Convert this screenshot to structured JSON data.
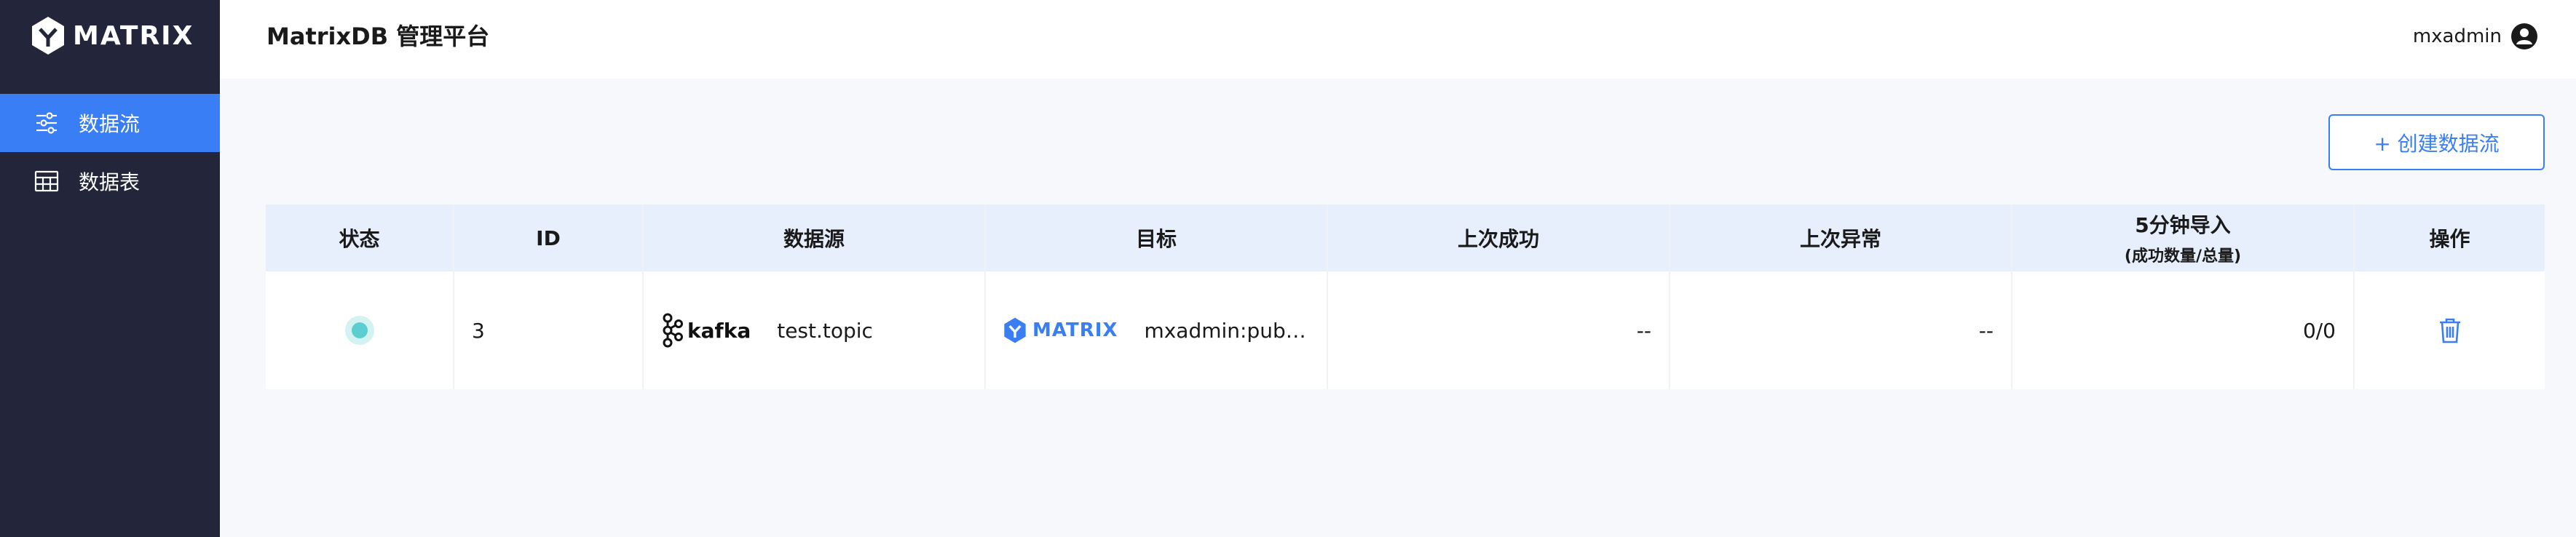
{
  "brand": {
    "name": "MATRIX",
    "accent": "#3a7ef6",
    "sidebar_bg": "#23263a"
  },
  "sidebar": {
    "items": [
      {
        "label": "数据流",
        "icon": "data-flow-icon",
        "active": true
      },
      {
        "label": "数据表",
        "icon": "table-icon",
        "active": false
      }
    ]
  },
  "header": {
    "title": "MatrixDB 管理平台",
    "user": {
      "name": "mxadmin",
      "icon": "user-avatar-icon"
    }
  },
  "toolbar": {
    "create_label": "+ 创建数据流"
  },
  "table": {
    "headers": {
      "status": "状态",
      "id": "ID",
      "source": "数据源",
      "target": "目标",
      "last_success": "上次成功",
      "last_error": "上次异常",
      "import_5min": "5分钟导入",
      "import_5min_sub": "(成功数量/总量)",
      "actions": "操作"
    },
    "rows": [
      {
        "status": "running",
        "status_color": "#5ccdd0",
        "id": "3",
        "source_logo": "kafka",
        "source_topic": "test.topic",
        "target_logo": "MATRIX",
        "target": "mxadmin:public:d...",
        "last_success": "--",
        "last_error": "--",
        "import_5min": "0/0",
        "action_icon": "trash-icon"
      }
    ]
  }
}
